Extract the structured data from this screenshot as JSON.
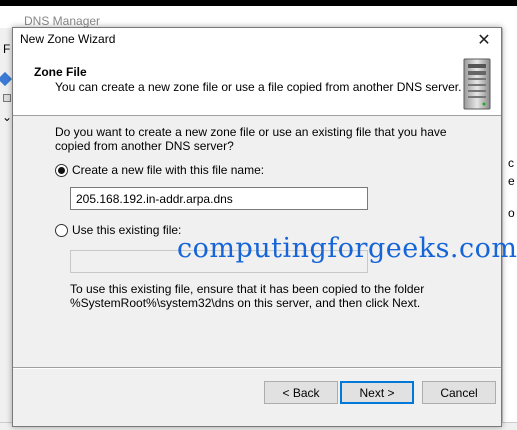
{
  "background_window": {
    "title": "DNS Manager",
    "left_fragment": "F",
    "right_fragment_1": "c",
    "right_fragment_2": "e",
    "right_fragment_3": "o"
  },
  "dialog": {
    "title": "New Zone Wizard",
    "close_glyph": "✕",
    "header": {
      "heading": "Zone File",
      "description": "You can create a new zone file or use a file copied from another DNS server."
    },
    "question": "Do you want to create a new zone file or use an existing file that you have copied from another DNS server?",
    "options": [
      {
        "label": "Create a new file with this file name:",
        "selected": true
      },
      {
        "label": "Use this existing file:",
        "selected": false
      }
    ],
    "new_file_name": "205.168.192.in-addr.arpa.dns",
    "existing_file_name": "",
    "help_text": "To use this existing file, ensure that it has been copied to the folder %SystemRoot%\\system32\\dns on this server, and then click Next.",
    "buttons": {
      "back": "< Back",
      "next": "Next >",
      "cancel": "Cancel"
    }
  },
  "watermark": "computingforgeeks.com",
  "colors": {
    "watermark": "#1565d8",
    "default_button_border": "#0078d7",
    "dialog_bg": "#f0f0f0"
  },
  "icons": [
    "server-icon",
    "close-icon",
    "radio-selected-icon",
    "radio-unselected-icon"
  ]
}
